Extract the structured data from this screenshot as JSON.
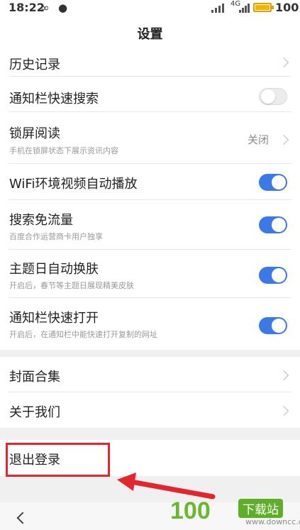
{
  "status": {
    "time": "18:22",
    "battery": "100",
    "network": "4G"
  },
  "header": {
    "title": "设置"
  },
  "items": [
    {
      "label": "历史记录"
    },
    {
      "label": "通知栏快速搜索",
      "toggle": "off"
    },
    {
      "label": "锁屏阅读",
      "sub": "手机在锁屏状态下展示资讯内容",
      "value": "关闭"
    },
    {
      "label": "WiFi环境视频自动播放",
      "toggle": "on"
    },
    {
      "label": "搜索免流量",
      "sub": "百度合作运营商卡用户独享",
      "toggle": "on"
    },
    {
      "label": "主题日自动换肤",
      "sub": "开启后，春节等主题日展现精美皮肤",
      "toggle": "on"
    },
    {
      "label": "通知栏快速打开",
      "sub": "开启后，在通知栏中能快速打开复制的网址",
      "toggle": "on"
    }
  ],
  "section2": [
    {
      "label": "封面合集"
    },
    {
      "label": "关于我们"
    }
  ],
  "logout": {
    "label": "退出登录"
  },
  "watermark": {
    "number": "100",
    "tag": "下载站",
    "url": "www.downcc.com"
  },
  "colors": {
    "accent": "#3b79e8",
    "highlight": "#e3262e"
  }
}
